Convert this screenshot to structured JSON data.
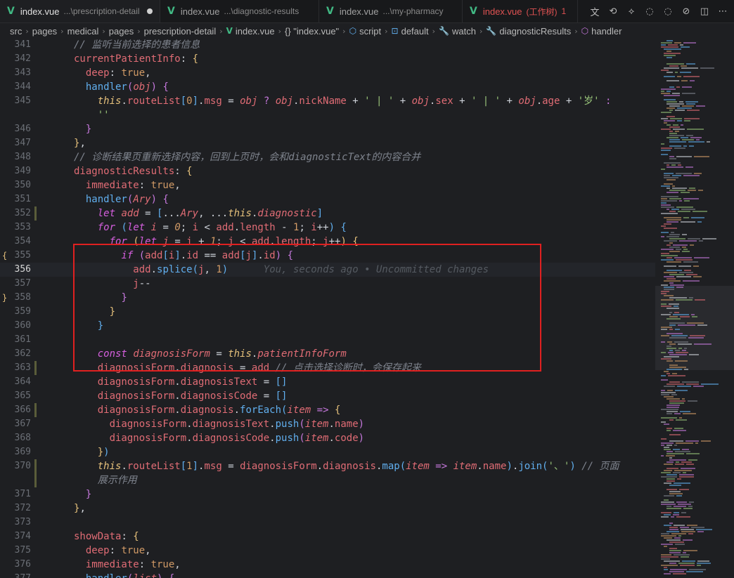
{
  "tabs": [
    {
      "name": "index.vue",
      "path": "...\\prescription-detail",
      "active": true,
      "dirty": true
    },
    {
      "name": "index.vue",
      "path": "...\\diagnostic-results",
      "active": false
    },
    {
      "name": "index.vue",
      "path": "...\\my-pharmacy",
      "active": false
    },
    {
      "name": "index.vue",
      "path": "(工作树)",
      "active": false,
      "modified": true,
      "badge": "1"
    }
  ],
  "breadcrumb": {
    "items": [
      "src",
      "pages",
      "medical",
      "pages",
      "prescription-detail",
      "index.vue",
      "{} \"index.vue\"",
      "script",
      "default",
      "watch",
      "diagnosticResults",
      "handler"
    ]
  },
  "editor": {
    "current_line": "356",
    "blame": "You, seconds ago • Uncommitted changes",
    "lines": [
      {
        "n": "341"
      },
      {
        "n": "342"
      },
      {
        "n": "343"
      },
      {
        "n": "344"
      },
      {
        "n": "345"
      },
      {
        "n": ""
      },
      {
        "n": "346"
      },
      {
        "n": "347"
      },
      {
        "n": "348"
      },
      {
        "n": "349"
      },
      {
        "n": "350"
      },
      {
        "n": "351"
      },
      {
        "n": "352"
      },
      {
        "n": "353"
      },
      {
        "n": "354"
      },
      {
        "n": "355"
      },
      {
        "n": "356"
      },
      {
        "n": "357"
      },
      {
        "n": "358"
      },
      {
        "n": "359"
      },
      {
        "n": "360"
      },
      {
        "n": "361"
      },
      {
        "n": "362"
      },
      {
        "n": "363"
      },
      {
        "n": "364"
      },
      {
        "n": "365"
      },
      {
        "n": "366"
      },
      {
        "n": "367"
      },
      {
        "n": "368"
      },
      {
        "n": "369"
      },
      {
        "n": "370"
      },
      {
        "n": ""
      },
      {
        "n": "371"
      },
      {
        "n": "372"
      },
      {
        "n": "373"
      },
      {
        "n": "374"
      },
      {
        "n": "375"
      },
      {
        "n": "376"
      },
      {
        "n": "377"
      }
    ],
    "code": {
      "l341": "// 监听当前选择的患者信息",
      "l348": "// 诊断结果页重新选择内容，回到上页时，会和diagnosticText的内容合并",
      "l363c": "// 点击选择诊断时，会保存起来",
      "l370c": "// 页面",
      "l370c2": "展示作用",
      "sep1": "' | '",
      "sep2": "' | '",
      "sui": "'岁'",
      "empty": "''",
      "dun": "'、'"
    }
  },
  "colors": {
    "accent": "#41b883",
    "highlight_box": "#e02020",
    "modified": "#e05252"
  }
}
